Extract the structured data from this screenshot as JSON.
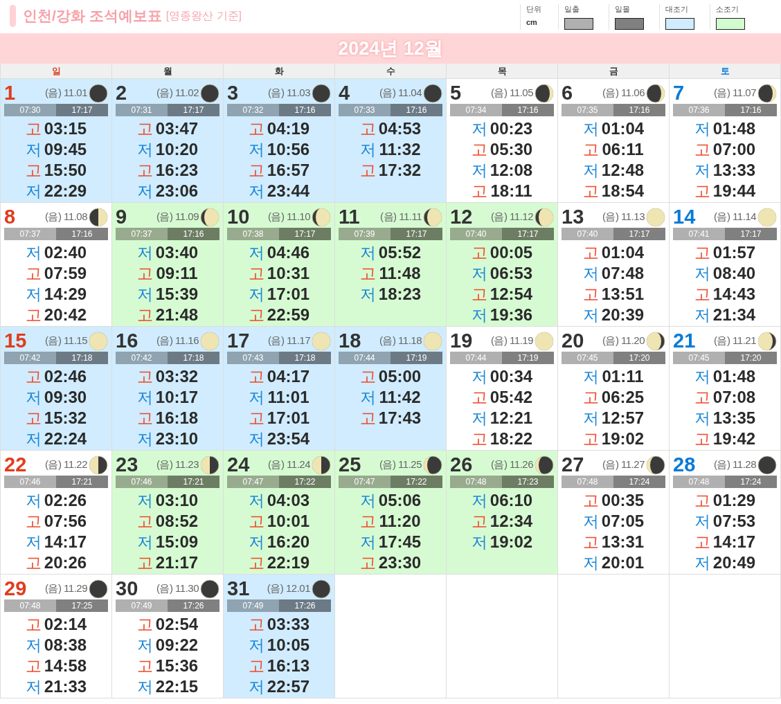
{
  "header": {
    "title": "인천/강화 조석예보표",
    "subtitle": "[영종왕산 기준]",
    "unit": {
      "label": "단위",
      "value": "cm"
    },
    "legend": [
      {
        "label": "일출",
        "color": "#b0b0b0"
      },
      {
        "label": "일몰",
        "color": "#808080"
      },
      {
        "label": "대조기",
        "color": "#d0ecfe"
      },
      {
        "label": "소조기",
        "color": "#d3fbd0"
      }
    ]
  },
  "month": "2024년 12월",
  "weekdays": [
    {
      "label": "일",
      "color": "#e03c1e"
    },
    {
      "label": "월",
      "color": "#333333"
    },
    {
      "label": "화",
      "color": "#333333"
    },
    {
      "label": "수",
      "color": "#333333"
    },
    {
      "label": "목",
      "color": "#333333"
    },
    {
      "label": "금",
      "color": "#333333"
    },
    {
      "label": "토",
      "color": "#0a7bd6"
    }
  ],
  "days": [
    {
      "day": "1",
      "lunar": "(음) 11.01",
      "moon": {
        "kind": "new"
      },
      "kind": "spring",
      "sunrise": "07:30",
      "sunset": "17:17",
      "tides": [
        {
          "kind": "high",
          "label": "고",
          "time": "03:15"
        },
        {
          "kind": "low",
          "label": "저",
          "time": "09:45"
        },
        {
          "kind": "high",
          "label": "고",
          "time": "15:50"
        },
        {
          "kind": "low",
          "label": "저",
          "time": "22:29"
        }
      ]
    },
    {
      "day": "2",
      "lunar": "(음) 11.02",
      "moon": {
        "kind": "new"
      },
      "kind": "spring",
      "sunrise": "07:31",
      "sunset": "17:17",
      "tides": [
        {
          "kind": "high",
          "label": "고",
          "time": "03:47"
        },
        {
          "kind": "low",
          "label": "저",
          "time": "10:20"
        },
        {
          "kind": "high",
          "label": "고",
          "time": "16:23"
        },
        {
          "kind": "low",
          "label": "저",
          "time": "23:06"
        }
      ]
    },
    {
      "day": "3",
      "lunar": "(음) 11.03",
      "moon": {
        "kind": "new"
      },
      "kind": "spring",
      "sunrise": "07:32",
      "sunset": "17:16",
      "tides": [
        {
          "kind": "high",
          "label": "고",
          "time": "04:19"
        },
        {
          "kind": "low",
          "label": "저",
          "time": "10:56"
        },
        {
          "kind": "high",
          "label": "고",
          "time": "16:57"
        },
        {
          "kind": "low",
          "label": "저",
          "time": "23:44"
        }
      ]
    },
    {
      "day": "4",
      "lunar": "(음) 11.04",
      "moon": {
        "kind": "new"
      },
      "kind": "spring",
      "sunrise": "07:33",
      "sunset": "17:16",
      "tides": [
        {
          "kind": "high",
          "label": "고",
          "time": "04:53"
        },
        {
          "kind": "low",
          "label": "저",
          "time": "11:32"
        },
        {
          "kind": "high",
          "label": "고",
          "time": "17:32"
        }
      ]
    },
    {
      "day": "5",
      "lunar": "(음) 11.05",
      "moon": {
        "kind": "crescent-waxing"
      },
      "kind": "none",
      "sunrise": "07:34",
      "sunset": "17:16",
      "tides": [
        {
          "kind": "low",
          "label": "저",
          "time": "00:23"
        },
        {
          "kind": "high",
          "label": "고",
          "time": "05:30"
        },
        {
          "kind": "low",
          "label": "저",
          "time": "12:08"
        },
        {
          "kind": "high",
          "label": "고",
          "time": "18:11"
        }
      ]
    },
    {
      "day": "6",
      "lunar": "(음) 11.06",
      "moon": {
        "kind": "crescent-waxing"
      },
      "kind": "none",
      "sunrise": "07:35",
      "sunset": "17:16",
      "tides": [
        {
          "kind": "low",
          "label": "저",
          "time": "01:04"
        },
        {
          "kind": "high",
          "label": "고",
          "time": "06:11"
        },
        {
          "kind": "low",
          "label": "저",
          "time": "12:48"
        },
        {
          "kind": "high",
          "label": "고",
          "time": "18:54"
        }
      ]
    },
    {
      "day": "7",
      "lunar": "(음) 11.07",
      "moon": {
        "kind": "crescent-waxing"
      },
      "kind": "none",
      "sunrise": "07:36",
      "sunset": "17:16",
      "tides": [
        {
          "kind": "low",
          "label": "저",
          "time": "01:48"
        },
        {
          "kind": "high",
          "label": "고",
          "time": "07:00"
        },
        {
          "kind": "low",
          "label": "저",
          "time": "13:33"
        },
        {
          "kind": "high",
          "label": "고",
          "time": "19:44"
        }
      ]
    },
    {
      "day": "8",
      "lunar": "(음) 11.08",
      "moon": {
        "kind": "quarter-first"
      },
      "kind": "none",
      "sunrise": "07:37",
      "sunset": "17:16",
      "tides": [
        {
          "kind": "low",
          "label": "저",
          "time": "02:40"
        },
        {
          "kind": "high",
          "label": "고",
          "time": "07:59"
        },
        {
          "kind": "low",
          "label": "저",
          "time": "14:29"
        },
        {
          "kind": "high",
          "label": "고",
          "time": "20:42"
        }
      ]
    },
    {
      "day": "9",
      "lunar": "(음) 11.09",
      "moon": {
        "kind": "gibbous-waxing"
      },
      "kind": "neap",
      "sunrise": "07:37",
      "sunset": "17:16",
      "tides": [
        {
          "kind": "low",
          "label": "저",
          "time": "03:40"
        },
        {
          "kind": "high",
          "label": "고",
          "time": "09:11"
        },
        {
          "kind": "low",
          "label": "저",
          "time": "15:39"
        },
        {
          "kind": "high",
          "label": "고",
          "time": "21:48"
        }
      ]
    },
    {
      "day": "10",
      "lunar": "(음) 11.10",
      "moon": {
        "kind": "gibbous-waxing"
      },
      "kind": "neap",
      "sunrise": "07:38",
      "sunset": "17:17",
      "tides": [
        {
          "kind": "low",
          "label": "저",
          "time": "04:46"
        },
        {
          "kind": "high",
          "label": "고",
          "time": "10:31"
        },
        {
          "kind": "low",
          "label": "저",
          "time": "17:01"
        },
        {
          "kind": "high",
          "label": "고",
          "time": "22:59"
        }
      ]
    },
    {
      "day": "11",
      "lunar": "(음) 11.11",
      "moon": {
        "kind": "gibbous-waxing"
      },
      "kind": "neap",
      "sunrise": "07:39",
      "sunset": "17:17",
      "tides": [
        {
          "kind": "low",
          "label": "저",
          "time": "05:52"
        },
        {
          "kind": "high",
          "label": "고",
          "time": "11:48"
        },
        {
          "kind": "low",
          "label": "저",
          "time": "18:23"
        }
      ]
    },
    {
      "day": "12",
      "lunar": "(음) 11.12",
      "moon": {
        "kind": "gibbous-waxing"
      },
      "kind": "neap",
      "sunrise": "07:40",
      "sunset": "17:17",
      "tides": [
        {
          "kind": "high",
          "label": "고",
          "time": "00:05"
        },
        {
          "kind": "low",
          "label": "저",
          "time": "06:53"
        },
        {
          "kind": "high",
          "label": "고",
          "time": "12:54"
        },
        {
          "kind": "low",
          "label": "저",
          "time": "19:36"
        }
      ]
    },
    {
      "day": "13",
      "lunar": "(음) 11.13",
      "moon": {
        "kind": "full"
      },
      "kind": "none",
      "sunrise": "07:40",
      "sunset": "17:17",
      "tides": [
        {
          "kind": "high",
          "label": "고",
          "time": "01:04"
        },
        {
          "kind": "low",
          "label": "저",
          "time": "07:48"
        },
        {
          "kind": "high",
          "label": "고",
          "time": "13:51"
        },
        {
          "kind": "low",
          "label": "저",
          "time": "20:39"
        }
      ]
    },
    {
      "day": "14",
      "lunar": "(음) 11.14",
      "moon": {
        "kind": "full"
      },
      "kind": "none",
      "sunrise": "07:41",
      "sunset": "17:17",
      "tides": [
        {
          "kind": "high",
          "label": "고",
          "time": "01:57"
        },
        {
          "kind": "low",
          "label": "저",
          "time": "08:40"
        },
        {
          "kind": "high",
          "label": "고",
          "time": "14:43"
        },
        {
          "kind": "low",
          "label": "저",
          "time": "21:34"
        }
      ]
    },
    {
      "day": "15",
      "lunar": "(음) 11.15",
      "moon": {
        "kind": "full"
      },
      "kind": "spring",
      "sunrise": "07:42",
      "sunset": "17:18",
      "tides": [
        {
          "kind": "high",
          "label": "고",
          "time": "02:46"
        },
        {
          "kind": "low",
          "label": "저",
          "time": "09:30"
        },
        {
          "kind": "high",
          "label": "고",
          "time": "15:32"
        },
        {
          "kind": "low",
          "label": "저",
          "time": "22:24"
        }
      ]
    },
    {
      "day": "16",
      "lunar": "(음) 11.16",
      "moon": {
        "kind": "full"
      },
      "kind": "spring",
      "sunrise": "07:42",
      "sunset": "17:18",
      "tides": [
        {
          "kind": "high",
          "label": "고",
          "time": "03:32"
        },
        {
          "kind": "low",
          "label": "저",
          "time": "10:17"
        },
        {
          "kind": "high",
          "label": "고",
          "time": "16:18"
        },
        {
          "kind": "low",
          "label": "저",
          "time": "23:10"
        }
      ]
    },
    {
      "day": "17",
      "lunar": "(음) 11.17",
      "moon": {
        "kind": "full"
      },
      "kind": "spring",
      "sunrise": "07:43",
      "sunset": "17:18",
      "tides": [
        {
          "kind": "high",
          "label": "고",
          "time": "04:17"
        },
        {
          "kind": "low",
          "label": "저",
          "time": "11:01"
        },
        {
          "kind": "high",
          "label": "고",
          "time": "17:01"
        },
        {
          "kind": "low",
          "label": "저",
          "time": "23:54"
        }
      ]
    },
    {
      "day": "18",
      "lunar": "(음) 11.18",
      "moon": {
        "kind": "full"
      },
      "kind": "spring",
      "sunrise": "07:44",
      "sunset": "17:19",
      "tides": [
        {
          "kind": "high",
          "label": "고",
          "time": "05:00"
        },
        {
          "kind": "low",
          "label": "저",
          "time": "11:42"
        },
        {
          "kind": "high",
          "label": "고",
          "time": "17:43"
        }
      ]
    },
    {
      "day": "19",
      "lunar": "(음) 11.19",
      "moon": {
        "kind": "full"
      },
      "kind": "none",
      "sunrise": "07:44",
      "sunset": "17:19",
      "tides": [
        {
          "kind": "low",
          "label": "저",
          "time": "00:34"
        },
        {
          "kind": "high",
          "label": "고",
          "time": "05:42"
        },
        {
          "kind": "low",
          "label": "저",
          "time": "12:21"
        },
        {
          "kind": "high",
          "label": "고",
          "time": "18:22"
        }
      ]
    },
    {
      "day": "20",
      "lunar": "(음) 11.20",
      "moon": {
        "kind": "gibbous-waning"
      },
      "kind": "none",
      "sunrise": "07:45",
      "sunset": "17:20",
      "tides": [
        {
          "kind": "low",
          "label": "저",
          "time": "01:11"
        },
        {
          "kind": "high",
          "label": "고",
          "time": "06:25"
        },
        {
          "kind": "low",
          "label": "저",
          "time": "12:57"
        },
        {
          "kind": "high",
          "label": "고",
          "time": "19:02"
        }
      ]
    },
    {
      "day": "21",
      "lunar": "(음) 11.21",
      "moon": {
        "kind": "gibbous-waning"
      },
      "kind": "none",
      "sunrise": "07:45",
      "sunset": "17:20",
      "tides": [
        {
          "kind": "low",
          "label": "저",
          "time": "01:48"
        },
        {
          "kind": "high",
          "label": "고",
          "time": "07:08"
        },
        {
          "kind": "low",
          "label": "저",
          "time": "13:35"
        },
        {
          "kind": "high",
          "label": "고",
          "time": "19:42"
        }
      ]
    },
    {
      "day": "22",
      "lunar": "(음) 11.22",
      "moon": {
        "kind": "quarter-last"
      },
      "kind": "none",
      "sunrise": "07:46",
      "sunset": "17:21",
      "tides": [
        {
          "kind": "low",
          "label": "저",
          "time": "02:26"
        },
        {
          "kind": "high",
          "label": "고",
          "time": "07:56"
        },
        {
          "kind": "low",
          "label": "저",
          "time": "14:17"
        },
        {
          "kind": "high",
          "label": "고",
          "time": "20:26"
        }
      ]
    },
    {
      "day": "23",
      "lunar": "(음) 11.23",
      "moon": {
        "kind": "quarter-last"
      },
      "kind": "neap",
      "sunrise": "07:46",
      "sunset": "17:21",
      "tides": [
        {
          "kind": "low",
          "label": "저",
          "time": "03:10"
        },
        {
          "kind": "high",
          "label": "고",
          "time": "08:52"
        },
        {
          "kind": "low",
          "label": "저",
          "time": "15:09"
        },
        {
          "kind": "high",
          "label": "고",
          "time": "21:17"
        }
      ]
    },
    {
      "day": "24",
      "lunar": "(음) 11.24",
      "moon": {
        "kind": "quarter-last"
      },
      "kind": "neap",
      "sunrise": "07:47",
      "sunset": "17:22",
      "tides": [
        {
          "kind": "low",
          "label": "저",
          "time": "04:03"
        },
        {
          "kind": "high",
          "label": "고",
          "time": "10:01"
        },
        {
          "kind": "low",
          "label": "저",
          "time": "16:20"
        },
        {
          "kind": "high",
          "label": "고",
          "time": "22:19"
        }
      ]
    },
    {
      "day": "25",
      "lunar": "(음) 11.25",
      "moon": {
        "kind": "crescent-waning"
      },
      "kind": "neap",
      "sunrise": "07:47",
      "sunset": "17:22",
      "tides": [
        {
          "kind": "low",
          "label": "저",
          "time": "05:06"
        },
        {
          "kind": "high",
          "label": "고",
          "time": "11:20"
        },
        {
          "kind": "low",
          "label": "저",
          "time": "17:45"
        },
        {
          "kind": "high",
          "label": "고",
          "time": "23:30"
        }
      ]
    },
    {
      "day": "26",
      "lunar": "(음) 11.26",
      "moon": {
        "kind": "crescent-waning"
      },
      "kind": "neap",
      "sunrise": "07:48",
      "sunset": "17:23",
      "tides": [
        {
          "kind": "low",
          "label": "저",
          "time": "06:10"
        },
        {
          "kind": "high",
          "label": "고",
          "time": "12:34"
        },
        {
          "kind": "low",
          "label": "저",
          "time": "19:02"
        }
      ]
    },
    {
      "day": "27",
      "lunar": "(음) 11.27",
      "moon": {
        "kind": "crescent-waning"
      },
      "kind": "none",
      "sunrise": "07:48",
      "sunset": "17:24",
      "tides": [
        {
          "kind": "high",
          "label": "고",
          "time": "00:35"
        },
        {
          "kind": "low",
          "label": "저",
          "time": "07:05"
        },
        {
          "kind": "high",
          "label": "고",
          "time": "13:31"
        },
        {
          "kind": "low",
          "label": "저",
          "time": "20:01"
        }
      ]
    },
    {
      "day": "28",
      "lunar": "(음) 11.28",
      "moon": {
        "kind": "new"
      },
      "kind": "none",
      "sunrise": "07:48",
      "sunset": "17:24",
      "tides": [
        {
          "kind": "high",
          "label": "고",
          "time": "01:29"
        },
        {
          "kind": "low",
          "label": "저",
          "time": "07:53"
        },
        {
          "kind": "high",
          "label": "고",
          "time": "14:17"
        },
        {
          "kind": "low",
          "label": "저",
          "time": "20:49"
        }
      ]
    },
    {
      "day": "29",
      "lunar": "(음) 11.29",
      "moon": {
        "kind": "new"
      },
      "kind": "none",
      "sunrise": "07:48",
      "sunset": "17:25",
      "tides": [
        {
          "kind": "high",
          "label": "고",
          "time": "02:14"
        },
        {
          "kind": "low",
          "label": "저",
          "time": "08:38"
        },
        {
          "kind": "high",
          "label": "고",
          "time": "14:58"
        },
        {
          "kind": "low",
          "label": "저",
          "time": "21:33"
        }
      ]
    },
    {
      "day": "30",
      "lunar": "(음) 11.30",
      "moon": {
        "kind": "new"
      },
      "kind": "none",
      "sunrise": "07:49",
      "sunset": "17:26",
      "tides": [
        {
          "kind": "high",
          "label": "고",
          "time": "02:54"
        },
        {
          "kind": "low",
          "label": "저",
          "time": "09:22"
        },
        {
          "kind": "high",
          "label": "고",
          "time": "15:36"
        },
        {
          "kind": "low",
          "label": "저",
          "time": "22:15"
        }
      ]
    },
    {
      "day": "31",
      "lunar": "(음) 12.01",
      "moon": {
        "kind": "new"
      },
      "kind": "spring",
      "sunrise": "07:49",
      "sunset": "17:26",
      "tides": [
        {
          "kind": "high",
          "label": "고",
          "time": "03:33"
        },
        {
          "kind": "low",
          "label": "저",
          "time": "10:05"
        },
        {
          "kind": "high",
          "label": "고",
          "time": "16:13"
        },
        {
          "kind": "low",
          "label": "저",
          "time": "22:57"
        }
      ]
    }
  ]
}
